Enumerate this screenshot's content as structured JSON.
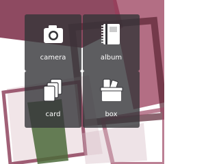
{
  "tiles": {
    "camera": {
      "label": "camera",
      "icon": "camera-icon"
    },
    "album": {
      "label": "album",
      "icon": "album-icon"
    },
    "card": {
      "label": "card",
      "icon": "card-stack-icon"
    },
    "box": {
      "label": "box",
      "icon": "box-icon"
    }
  },
  "colors": {
    "background": "#ffffff",
    "tile": "#343438",
    "icon": "#ffffff",
    "photo_maroon": "#7a2a45",
    "photo_green": "#4b6a3a"
  }
}
